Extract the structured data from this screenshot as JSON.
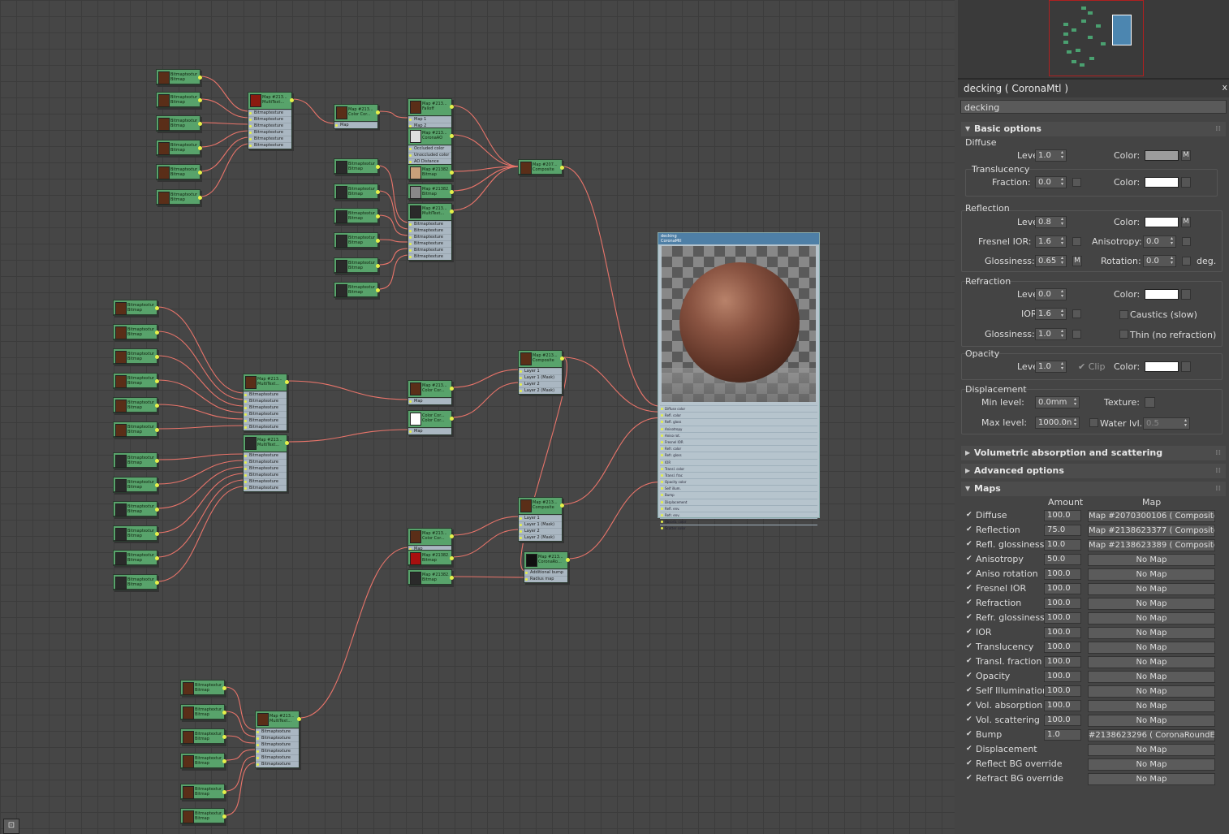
{
  "panel": {
    "title": "decking  ( CoronaMtl )",
    "close": "x",
    "material_name": "decking"
  },
  "basic": {
    "header": "Basic options",
    "diffuse_label": "Diffuse",
    "level_label": "Level:",
    "diffuse_level": "1.0",
    "color_label": "Color:",
    "diffuse_color": "#9c9c9c",
    "m": "M",
    "translucency_label": "Translucency",
    "fraction_label": "Fraction:",
    "fraction": "0.0",
    "transl_color": "#ffffff",
    "reflection_label": "Reflection",
    "refl_level": "0.8",
    "refl_color": "#ffffff",
    "fresnel_label": "Fresnel IOR:",
    "fresnel": "1.6",
    "aniso_label": "Anisotropy:",
    "aniso": "0.0",
    "gloss_label": "Glossiness:",
    "refl_gloss": "0.65",
    "rotation_label": "Rotation:",
    "rotation": "0.0",
    "deg": "deg.",
    "refraction_label": "Refraction",
    "refr_level": "0.0",
    "refr_color": "#ffffff",
    "ior_label": "IOR:",
    "ior": "1.6",
    "caustics": "Caustics (slow)",
    "refr_gloss": "1.0",
    "thin": "Thin (no refraction)",
    "opacity_label": "Opacity",
    "op_level": "1.0",
    "clip": "Clip",
    "op_color": "#ffffff",
    "displacement_label": "Displacement",
    "min_label": "Min level:",
    "min": "0.0mm",
    "texture_label": "Texture:",
    "max_label": "Max level:",
    "max": "1000.0n",
    "water_label": "Water lvl.:",
    "water": "0.5"
  },
  "rollouts": {
    "vol": "Volumetric absorption and scattering",
    "adv": "Advanced options",
    "maps": "Maps"
  },
  "maps": {
    "amount_col": "Amount",
    "map_col": "Map",
    "rows": [
      {
        "name": "Diffuse",
        "amount": "100.0",
        "map": "Map #2070300106  ( Composite )"
      },
      {
        "name": "Reflection",
        "amount": "75.0",
        "map": "Map #2138623377  ( Composite )"
      },
      {
        "name": "Refl. glossiness",
        "amount": "10.0",
        "map": "Map #2138623389  ( Composite )"
      },
      {
        "name": "Anisotropy",
        "amount": "50.0",
        "map": "No Map"
      },
      {
        "name": "Aniso rotation",
        "amount": "100.0",
        "map": "No Map"
      },
      {
        "name": "Fresnel IOR",
        "amount": "100.0",
        "map": "No Map"
      },
      {
        "name": "Refraction",
        "amount": "100.0",
        "map": "No Map"
      },
      {
        "name": "Refr. glossiness",
        "amount": "100.0",
        "map": "No Map"
      },
      {
        "name": "IOR",
        "amount": "100.0",
        "map": "No Map"
      },
      {
        "name": "Translucency",
        "amount": "100.0",
        "map": "No Map"
      },
      {
        "name": "Transl. fraction",
        "amount": "100.0",
        "map": "No Map"
      },
      {
        "name": "Opacity",
        "amount": "100.0",
        "map": "No Map"
      },
      {
        "name": "Self Illumination",
        "amount": "100.0",
        "map": "No Map"
      },
      {
        "name": "Vol. absorption",
        "amount": "100.0",
        "map": "No Map"
      },
      {
        "name": "Vol. scattering",
        "amount": "100.0",
        "map": "No Map"
      },
      {
        "name": "Bump",
        "amount": "1.0",
        "map": "#2138623296  ( CoronaRoundEd"
      },
      {
        "name": "Displacement",
        "amount": "",
        "map": "No Map"
      },
      {
        "name": "Reflect BG override",
        "amount": "",
        "map": "No Map"
      },
      {
        "name": "Refract BG override",
        "amount": "",
        "map": "No Map"
      }
    ]
  },
  "graph": {
    "bitmap_t1": "Bitmaptexture",
    "bitmap_t2": "Bitmap",
    "slot_bitmaptexture": "Bitmaptexture",
    "multitex_t1": "Map #213...",
    "multitex_t2": "MultiText...",
    "colorcor_t1": "Map #213...",
    "colorcor_t2": "Color Cor...",
    "slot_map": "Map",
    "falloff_t1": "Map #213...",
    "falloff_t2": "Falloff",
    "slot_map1": "Map 1",
    "slot_map2": "Map 2",
    "ao_t1": "Map #213...",
    "ao_t2": "CoronaAO",
    "slot_occluded": "Occluded color",
    "slot_unoccluded": "Unoccluded color",
    "slot_aodist": "AO Distance",
    "bm2_t1": "Map #21382...",
    "bm2_t2": "Bitmap",
    "comp_t1": "Map #207...",
    "comp_t2": "Composite",
    "comp2_t1": "Map #213...",
    "comp2_t2": "Composite",
    "slot_layer1": "Layer 1",
    "slot_layer1m": "Layer 1 (Mask)",
    "slot_layer2": "Layer 2",
    "slot_layer2m": "Layer 2 (Mask)",
    "cc2_t1": "Color Cor...",
    "cc2_t2": "Color Cor...",
    "round_t1": "Map #213...",
    "round_t2": "CoronaRo...",
    "slot_addbump": "Additional bump",
    "slot_radiusmap": "Radius map",
    "mtl_t1": "decking",
    "mtl_t2": "CoronaMtl",
    "mtl_slots": [
      "Diffuse color",
      "Refl. color",
      "Refl. gloss",
      "Anisotropy",
      "Aniso rot.",
      "Fresnel IOR",
      "Refr. color",
      "Refr. gloss",
      "IOR",
      "Transl. color",
      "Transl. frac",
      "Opacity color",
      "Self illum.",
      "Bump",
      "Displacement",
      "Refl. env.",
      "Refr. env.",
      "Absorb. color",
      "Scatter color"
    ],
    "binoculars": "⊡"
  }
}
